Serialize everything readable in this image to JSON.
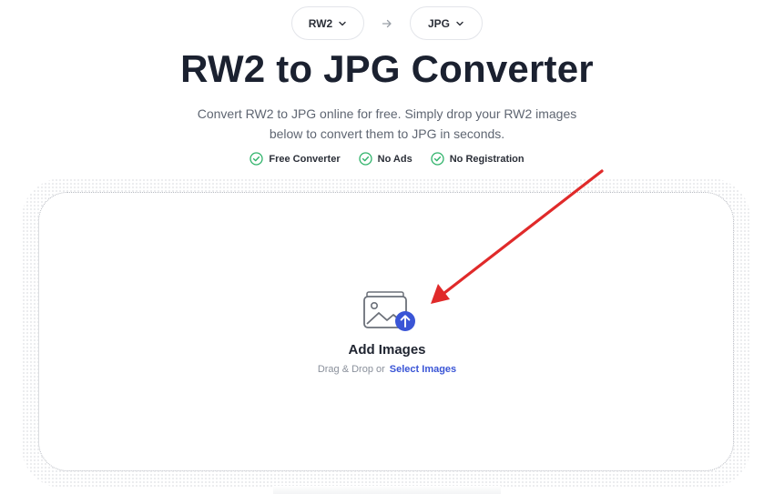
{
  "format_selector": {
    "from_label": "RW2",
    "to_label": "JPG"
  },
  "header": {
    "title": "RW2 to JPG Converter",
    "subtitle": "Convert RW2 to JPG online for free. Simply drop your RW2 images below to convert them to JPG in seconds."
  },
  "features": [
    {
      "label": "Free Converter",
      "icon": "check-circle-icon"
    },
    {
      "label": "No Ads",
      "icon": "check-circle-icon"
    },
    {
      "label": "No Registration",
      "icon": "check-circle-icon"
    }
  ],
  "dropzone": {
    "heading": "Add Images",
    "drag_text": "Drag & Drop or",
    "select_label": "Select Images",
    "icon": "image-upload-icon"
  },
  "colors": {
    "accent": "#3a55d6",
    "check_green": "#2fb36a",
    "annotation_red": "#e02a2a"
  }
}
